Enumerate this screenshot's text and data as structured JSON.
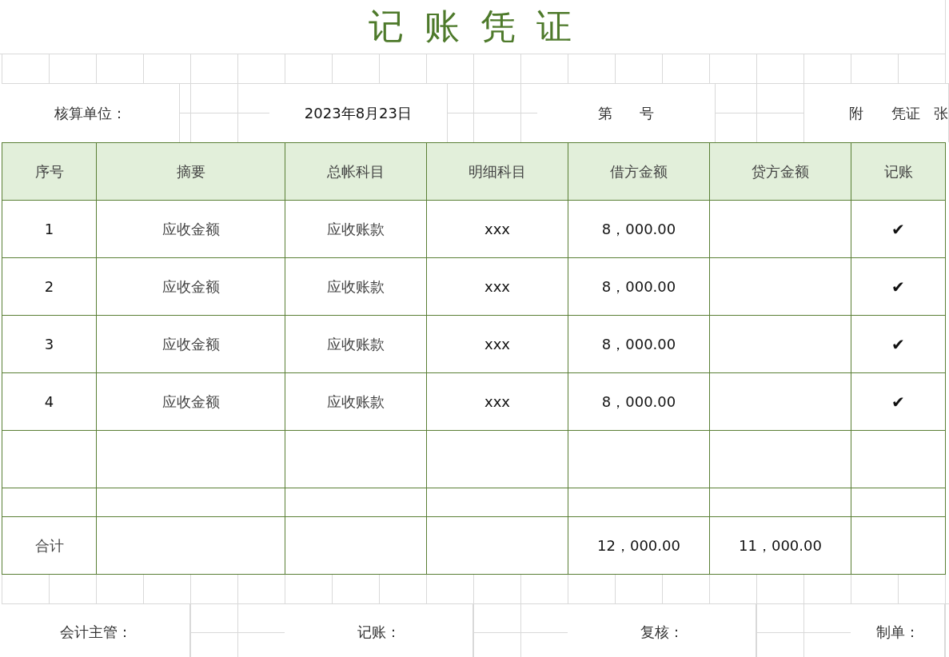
{
  "title": "记 账 凭 证",
  "info": {
    "unit_label": "核算单位：",
    "date": "2023年8月23日",
    "number_label": "第      号",
    "attachment_label": "附      凭证   张"
  },
  "table": {
    "columns": [
      "序号",
      "摘要",
      "总帐科目",
      "明细科目",
      "借方金额",
      "贷方金额",
      "记账"
    ],
    "rows": [
      {
        "seq": "1",
        "summary": "应收金额",
        "account": "应收账款",
        "detail": "xxx",
        "debit": "8，000.00",
        "mark": "✔"
      },
      {
        "seq": "2",
        "summary": "应收金额",
        "account": "应收账款",
        "detail": "xxx",
        "debit": "8，000.00",
        "mark": "✔"
      },
      {
        "seq": "3",
        "summary": "应收金额",
        "account": "应收账款",
        "detail": "xxx",
        "debit": "8，000.00",
        "mark": "✔"
      },
      {
        "seq": "4",
        "summary": "应收金额",
        "account": "应收账款",
        "detail": "xxx",
        "debit": "8，000.00",
        "mark": "✔"
      }
    ],
    "total": {
      "label": "合计",
      "debit": "12，000.00",
      "credit": "11，000.00"
    }
  },
  "footer": {
    "supervisor_label": "会计主管：",
    "bookkeeper_label": "记账：",
    "reviewer_label": "复核：",
    "preparer_label": "制单："
  }
}
